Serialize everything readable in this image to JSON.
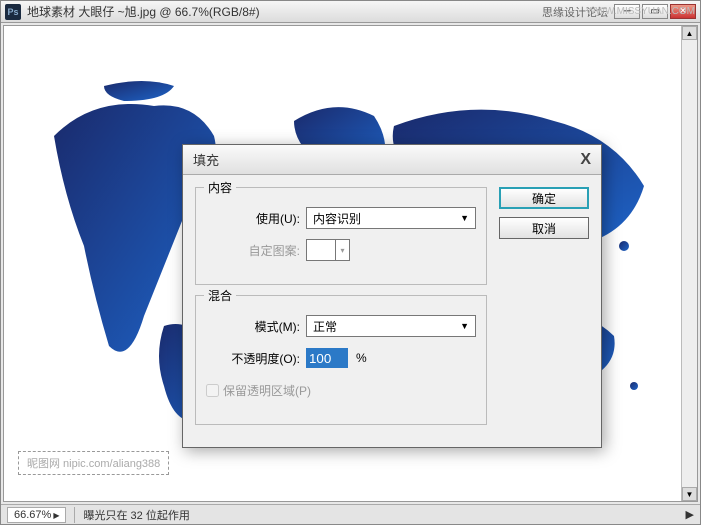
{
  "window": {
    "app_icon": "Ps",
    "title": "地球素材 大眼仔 ~旭.jpg @ 66.7%(RGB/8#)",
    "right_text": "思缘设计论坛",
    "watermark": "WWW.MISSYUAN.COM"
  },
  "canvas": {
    "watermark_text": "昵图网 nipic.com/aliang388"
  },
  "status": {
    "zoom": "66.67%",
    "hint": "曝光只在 32 位起作用"
  },
  "dialog": {
    "title": "填充",
    "close": "X",
    "group_content": "内容",
    "use_label": "使用(U):",
    "use_value": "内容识别",
    "pattern_label": "自定图案:",
    "group_blend": "混合",
    "mode_label": "模式(M):",
    "mode_value": "正常",
    "opacity_label": "不透明度(O):",
    "opacity_value": "100",
    "opacity_pct": "%",
    "preserve_label": "保留透明区域(P)",
    "ok": "确定",
    "cancel": "取消"
  }
}
